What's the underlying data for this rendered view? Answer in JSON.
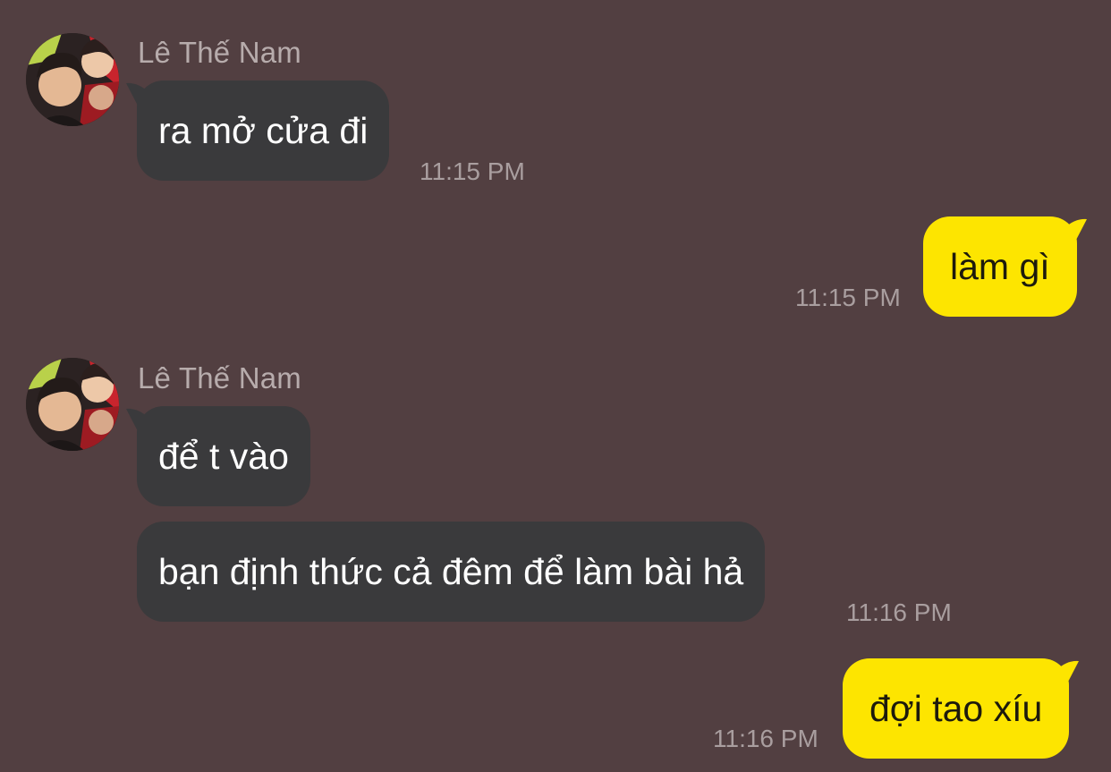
{
  "colors": {
    "background": "#523f41",
    "incoming_bubble": "#3a3a3c",
    "outgoing_bubble": "#fde500",
    "timestamp": "#a99e9f",
    "sender_name": "#b7acac"
  },
  "messages": [
    {
      "direction": "incoming",
      "sender": "Lê Thế Nam",
      "text": "ra mở cửa đi",
      "time": "11:15 PM"
    },
    {
      "direction": "outgoing",
      "text": "làm gì",
      "time": "11:15 PM"
    },
    {
      "direction": "incoming",
      "sender": "Lê Thế Nam",
      "text": "để t vào"
    },
    {
      "direction": "incoming",
      "text": "bạn định thức cả đêm để làm bài hả",
      "time": "11:16 PM"
    },
    {
      "direction": "outgoing",
      "text": "đợi tao xíu",
      "time": "11:16 PM"
    }
  ]
}
